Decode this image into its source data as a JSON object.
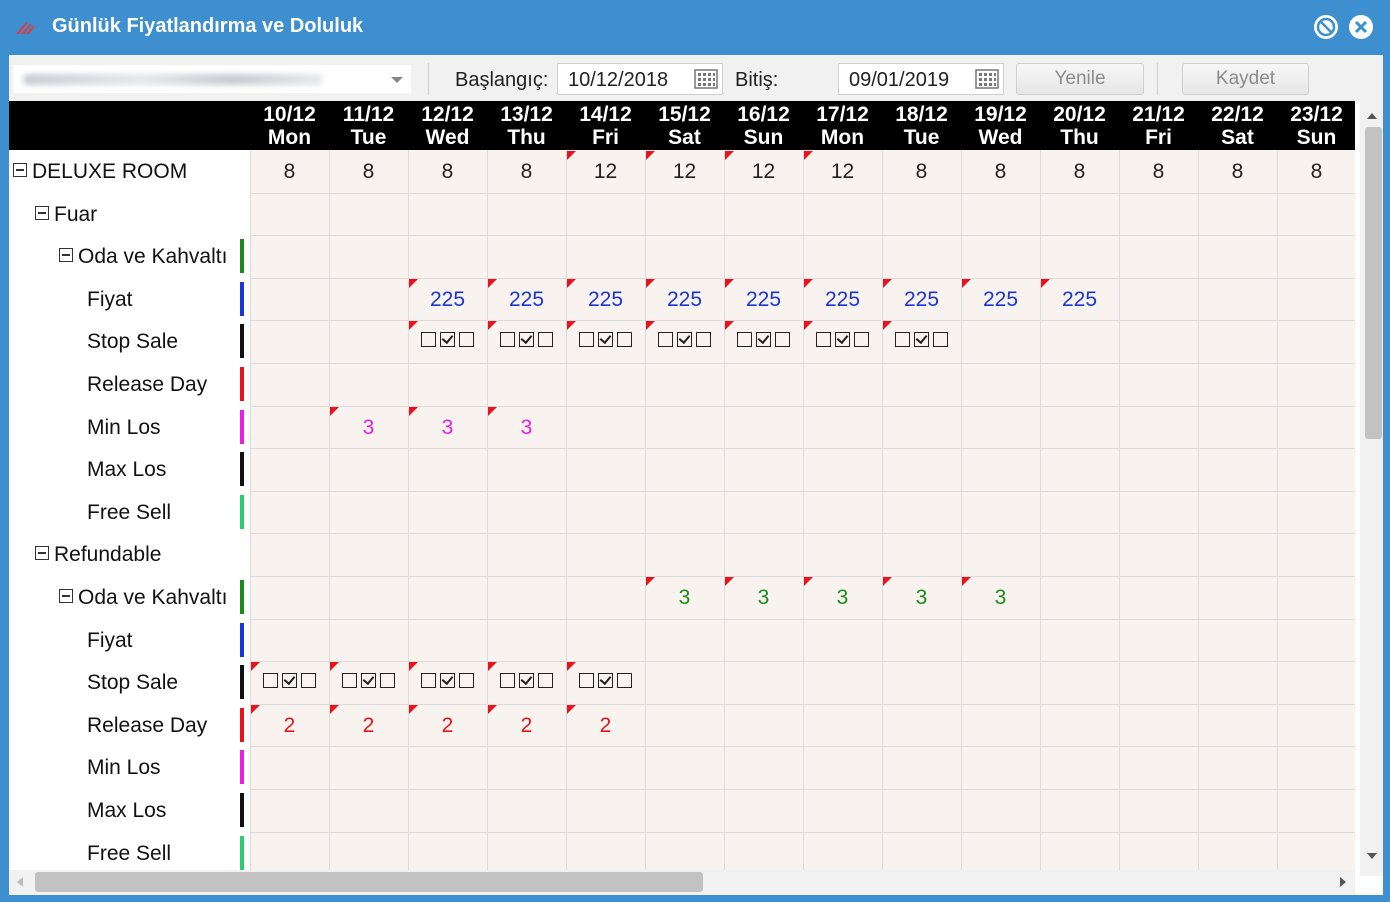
{
  "window": {
    "title": "Günlük Fiyatlandırma ve Doluluk"
  },
  "icons": {
    "logo": "app-logo-icon",
    "minimize": "minimize-icon",
    "close": "close-icon",
    "calendar": "calendar-icon"
  },
  "toolbar": {
    "start_label": "Başlangıç:",
    "start_value": "10/12/2018",
    "end_label": "Bitiş:",
    "end_value": "09/01/2019",
    "refresh_label": "Yenile",
    "save_label": "Kaydet"
  },
  "colors": {
    "accent": "#3d8fd0",
    "price": "#1a35d8",
    "min_los": "#e81ee8",
    "release": "#e8141d",
    "refundable_meal": "#1c8a1c",
    "flag": "#e8141d"
  },
  "header": {
    "dates": [
      {
        "date": "10/12",
        "day": "Mon"
      },
      {
        "date": "11/12",
        "day": "Tue"
      },
      {
        "date": "12/12",
        "day": "Wed"
      },
      {
        "date": "13/12",
        "day": "Thu"
      },
      {
        "date": "14/12",
        "day": "Fri"
      },
      {
        "date": "15/12",
        "day": "Sat"
      },
      {
        "date": "16/12",
        "day": "Sun"
      },
      {
        "date": "17/12",
        "day": "Mon"
      },
      {
        "date": "18/12",
        "day": "Tue"
      },
      {
        "date": "19/12",
        "day": "Wed"
      },
      {
        "date": "20/12",
        "day": "Thu"
      },
      {
        "date": "21/12",
        "day": "Fri"
      },
      {
        "date": "22/12",
        "day": "Sat"
      },
      {
        "date": "23/12",
        "day": "Sun"
      }
    ]
  },
  "rows": [
    {
      "label": "DELUXE ROOM",
      "level": 0,
      "toggle": true,
      "bar": "",
      "type": "text",
      "color": "#222",
      "values": [
        "8",
        "8",
        "8",
        "8",
        "12",
        "12",
        "12",
        "12",
        "8",
        "8",
        "8",
        "8",
        "8",
        "8"
      ],
      "flags": [
        4,
        5,
        6,
        7
      ]
    },
    {
      "label": "Fuar",
      "level": 1,
      "toggle": true,
      "bar": "",
      "type": "none"
    },
    {
      "label": "Oda ve Kahvaltı",
      "level": 2,
      "toggle": true,
      "bar": "#1c8a1c",
      "type": "none"
    },
    {
      "label": "Fiyat",
      "level": 3,
      "toggle": false,
      "bar": "#1a35d8",
      "type": "text",
      "color": "#1a35d8",
      "values": [
        "",
        "",
        "225",
        "225",
        "225",
        "225",
        "225",
        "225",
        "225",
        "225",
        "225",
        "",
        "",
        ""
      ],
      "flags": [
        2,
        3,
        4,
        5,
        6,
        7,
        8,
        9,
        10
      ]
    },
    {
      "label": "Stop Sale",
      "level": 3,
      "toggle": false,
      "bar": "#111111",
      "type": "check",
      "checks": [
        false,
        false,
        true,
        true,
        true,
        true,
        true,
        true,
        true,
        false,
        false,
        false,
        false,
        false
      ],
      "flags": [
        2,
        3,
        4,
        5,
        6,
        7,
        8
      ]
    },
    {
      "label": "Release Day",
      "level": 3,
      "toggle": false,
      "bar": "#e8141d",
      "type": "none"
    },
    {
      "label": "Min Los",
      "level": 3,
      "toggle": false,
      "bar": "#e81ee8",
      "type": "text",
      "color": "#e81ee8",
      "values": [
        "",
        "3",
        "3",
        "3",
        "",
        "",
        "",
        "",
        "",
        "",
        "",
        "",
        "",
        ""
      ],
      "flags": [
        1,
        2,
        3
      ]
    },
    {
      "label": "Max Los",
      "level": 3,
      "toggle": false,
      "bar": "#111111",
      "type": "none"
    },
    {
      "label": "Free Sell",
      "level": 3,
      "toggle": false,
      "bar": "#2ecc71",
      "type": "none"
    },
    {
      "label": "Refundable",
      "level": 1,
      "toggle": true,
      "bar": "",
      "type": "none"
    },
    {
      "label": "Oda ve Kahvaltı",
      "level": 2,
      "toggle": true,
      "bar": "#1c8a1c",
      "type": "text",
      "color": "#1c8a1c",
      "values": [
        "",
        "",
        "",
        "",
        "",
        "3",
        "3",
        "3",
        "3",
        "3",
        "",
        "",
        "",
        ""
      ],
      "flags": [
        5,
        6,
        7,
        8,
        9
      ]
    },
    {
      "label": "Fiyat",
      "level": 3,
      "toggle": false,
      "bar": "#1a35d8",
      "type": "none"
    },
    {
      "label": "Stop Sale",
      "level": 3,
      "toggle": false,
      "bar": "#111111",
      "type": "check",
      "checks": [
        true,
        true,
        true,
        true,
        true,
        false,
        false,
        false,
        false,
        false,
        false,
        false,
        false,
        false
      ],
      "flags": [
        0,
        1,
        2,
        3,
        4
      ]
    },
    {
      "label": "Release Day",
      "level": 3,
      "toggle": false,
      "bar": "#e8141d",
      "type": "text",
      "color": "#e8141d",
      "values": [
        "2",
        "2",
        "2",
        "2",
        "2",
        "",
        "",
        "",
        "",
        "",
        "",
        "",
        "",
        ""
      ],
      "flags": [
        0,
        1,
        2,
        3,
        4
      ]
    },
    {
      "label": "Min Los",
      "level": 3,
      "toggle": false,
      "bar": "#e81ee8",
      "type": "none"
    },
    {
      "label": "Max Los",
      "level": 3,
      "toggle": false,
      "bar": "#111111",
      "type": "none"
    },
    {
      "label": "Free Sell",
      "level": 3,
      "toggle": false,
      "bar": "#2ecc71",
      "type": "none"
    }
  ]
}
